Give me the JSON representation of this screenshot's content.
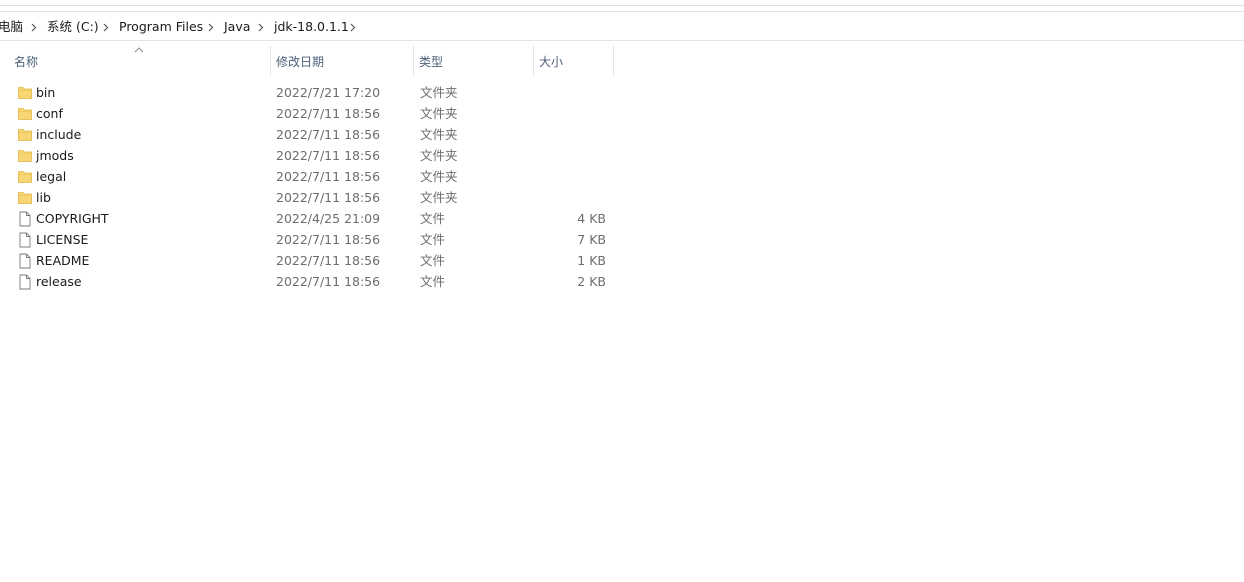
{
  "breadcrumb": {
    "items": [
      {
        "label": "电脑"
      },
      {
        "label": "系统 (C:)"
      },
      {
        "label": "Program Files"
      },
      {
        "label": "Java"
      },
      {
        "label": "jdk-18.0.1.1"
      }
    ]
  },
  "columns": {
    "name": "名称",
    "date": "修改日期",
    "type": "类型",
    "size": "大小"
  },
  "sort": {
    "column": "name",
    "direction": "ascending"
  },
  "colors": {
    "folder_icon": "#f8d675",
    "folder_icon_edge": "#e0b540",
    "header_text": "#4c607a",
    "meta_text": "#6d6d6d"
  },
  "files": [
    {
      "name": "bin",
      "date": "2022/7/21 17:20",
      "type": "文件夹",
      "size": "",
      "icon": "folder-icon"
    },
    {
      "name": "conf",
      "date": "2022/7/11 18:56",
      "type": "文件夹",
      "size": "",
      "icon": "folder-icon"
    },
    {
      "name": "include",
      "date": "2022/7/11 18:56",
      "type": "文件夹",
      "size": "",
      "icon": "folder-icon"
    },
    {
      "name": "jmods",
      "date": "2022/7/11 18:56",
      "type": "文件夹",
      "size": "",
      "icon": "folder-icon"
    },
    {
      "name": "legal",
      "date": "2022/7/11 18:56",
      "type": "文件夹",
      "size": "",
      "icon": "folder-icon"
    },
    {
      "name": "lib",
      "date": "2022/7/11 18:56",
      "type": "文件夹",
      "size": "",
      "icon": "folder-icon"
    },
    {
      "name": "COPYRIGHT",
      "date": "2022/4/25 21:09",
      "type": "文件",
      "size": "4 KB",
      "icon": "file-icon"
    },
    {
      "name": "LICENSE",
      "date": "2022/7/11 18:56",
      "type": "文件",
      "size": "7 KB",
      "icon": "file-icon"
    },
    {
      "name": "README",
      "date": "2022/7/11 18:56",
      "type": "文件",
      "size": "1 KB",
      "icon": "file-icon"
    },
    {
      "name": "release",
      "date": "2022/7/11 18:56",
      "type": "文件",
      "size": "2 KB",
      "icon": "file-icon"
    }
  ]
}
